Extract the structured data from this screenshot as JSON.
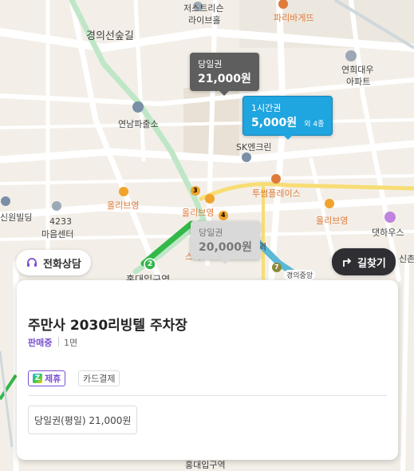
{
  "map": {
    "place_labels": [
      {
        "text": "저스트리슨",
        "cls": "dark"
      },
      {
        "text": "라이브홀",
        "cls": "dark"
      },
      {
        "text": "파리바게뜨",
        "cls": "orange"
      },
      {
        "text": "경의선숲길",
        "cls": "big"
      },
      {
        "text": "연희대우",
        "cls": "dark"
      },
      {
        "text": "아파트",
        "cls": "dark"
      },
      {
        "text": "연남파출소",
        "cls": "dark"
      },
      {
        "text": "SK엔크린",
        "cls": "dark"
      },
      {
        "text": "투썸플레이스",
        "cls": "orange"
      },
      {
        "text": "올리브영",
        "cls": "orange"
      },
      {
        "text": "올리브영",
        "cls": "orange"
      },
      {
        "text": "올리브영",
        "cls": "orange"
      },
      {
        "text": "신원빌딩",
        "cls": "dark"
      },
      {
        "text": "4233",
        "cls": "dark"
      },
      {
        "text": "마음센터",
        "cls": "dark"
      },
      {
        "text": "댓하우스",
        "cls": "dark"
      },
      {
        "text": "신촌",
        "cls": "dark"
      },
      {
        "text": "역",
        "cls": "dark"
      },
      {
        "text": "경의중앙",
        "cls": "dark"
      },
      {
        "text": "스타",
        "cls": "orange"
      },
      {
        "text": "홍대입구역",
        "cls": "dark"
      },
      {
        "text": "홍대입구역",
        "cls": "dark"
      }
    ],
    "subway_numbers": [
      "3",
      "4",
      "2",
      "7"
    ],
    "colors": {
      "background": "#f3efe8",
      "line2": "#33b84a",
      "airport_line": "#5bb8d6",
      "pin_selected": "#1fa5e0",
      "pin_default": "#5e5e5e"
    }
  },
  "pins": [
    {
      "title": "당일권",
      "value": "21,000원",
      "style": "dark"
    },
    {
      "title": "1시간권",
      "value": "5,000원",
      "extra": "외 4종",
      "style": "blue"
    },
    {
      "title": "당일권",
      "value": "20,000원",
      "style": "gray"
    }
  ],
  "buttons": {
    "consult": "전화상담",
    "directions": "길찾기"
  },
  "card": {
    "title": "주만사 2030리빙텔 주차장",
    "status": "판매중",
    "lanes": "1면",
    "tags": [
      "제휴",
      "카드결제"
    ],
    "partner_logo_letter": "Z",
    "price": "당일권(평일) 21,000원"
  }
}
